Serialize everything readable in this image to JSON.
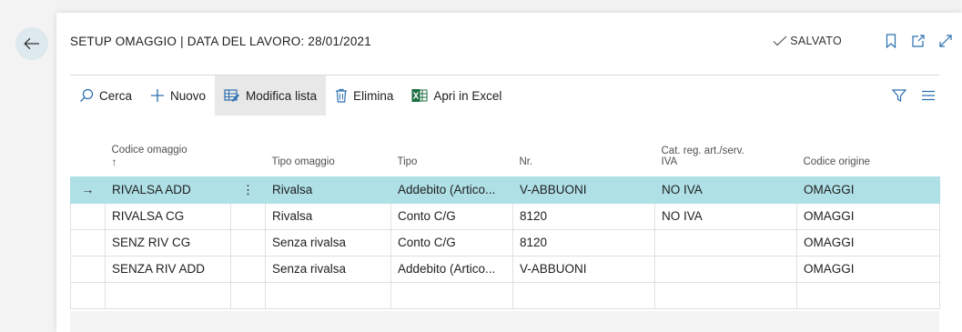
{
  "page": {
    "title": "SETUP OMAGGIO | DATA DEL LAVORO: 28/01/2021",
    "saved_label": "SALVATO"
  },
  "toolbar": {
    "search_label": "Cerca",
    "new_label": "Nuovo",
    "edit_list_label": "Modifica lista",
    "delete_label": "Elimina",
    "excel_label": "Apri in Excel"
  },
  "table": {
    "headers": {
      "codice_omaggio": "Codice omaggio",
      "sort_indicator": "↑",
      "tipo_omaggio": "Tipo omaggio",
      "tipo": "Tipo",
      "nr": "Nr.",
      "cat_line1": "Cat. reg. art./serv.",
      "cat_line2": "IVA",
      "codice_origine": "Codice origine"
    },
    "rows": [
      {
        "codice": "RIVALSA ADD",
        "tipo_omaggio": "Rivalsa",
        "tipo": "Addebito (Artico...",
        "nr": "V-ABBUONI",
        "cat": "NO IVA",
        "origine": "OMAGGI"
      },
      {
        "codice": "RIVALSA CG",
        "tipo_omaggio": "Rivalsa",
        "tipo": "Conto C/G",
        "nr": "8120",
        "cat": "NO IVA",
        "origine": "OMAGGI"
      },
      {
        "codice": "SENZ RIV CG",
        "tipo_omaggio": "Senza rivalsa",
        "tipo": "Conto C/G",
        "nr": "8120",
        "cat": "",
        "origine": "OMAGGI"
      },
      {
        "codice": "SENZA RIV ADD",
        "tipo_omaggio": "Senza rivalsa",
        "tipo": "Addebito (Artico...",
        "nr": "V-ABBUONI",
        "cat": "",
        "origine": "OMAGGI"
      }
    ],
    "selected_row_marker": "→",
    "context_menu_glyph": "⋮"
  },
  "colors": {
    "selected_row": "#aee0e6",
    "back_button_bg": "#dde9ee",
    "excel_green": "#1d6f42",
    "accent_blue": "#2a6fb0"
  },
  "icons": {
    "back": "arrow-left-icon",
    "saved": "checkmark-icon",
    "bookmark": "bookmark-icon",
    "open_new": "open-new-window-icon",
    "expand": "expand-icon",
    "search": "search-icon",
    "new": "plus-icon",
    "edit_list": "edit-list-icon",
    "delete": "trash-icon",
    "excel": "excel-icon",
    "filter": "filter-icon",
    "list_view": "list-view-icon"
  }
}
